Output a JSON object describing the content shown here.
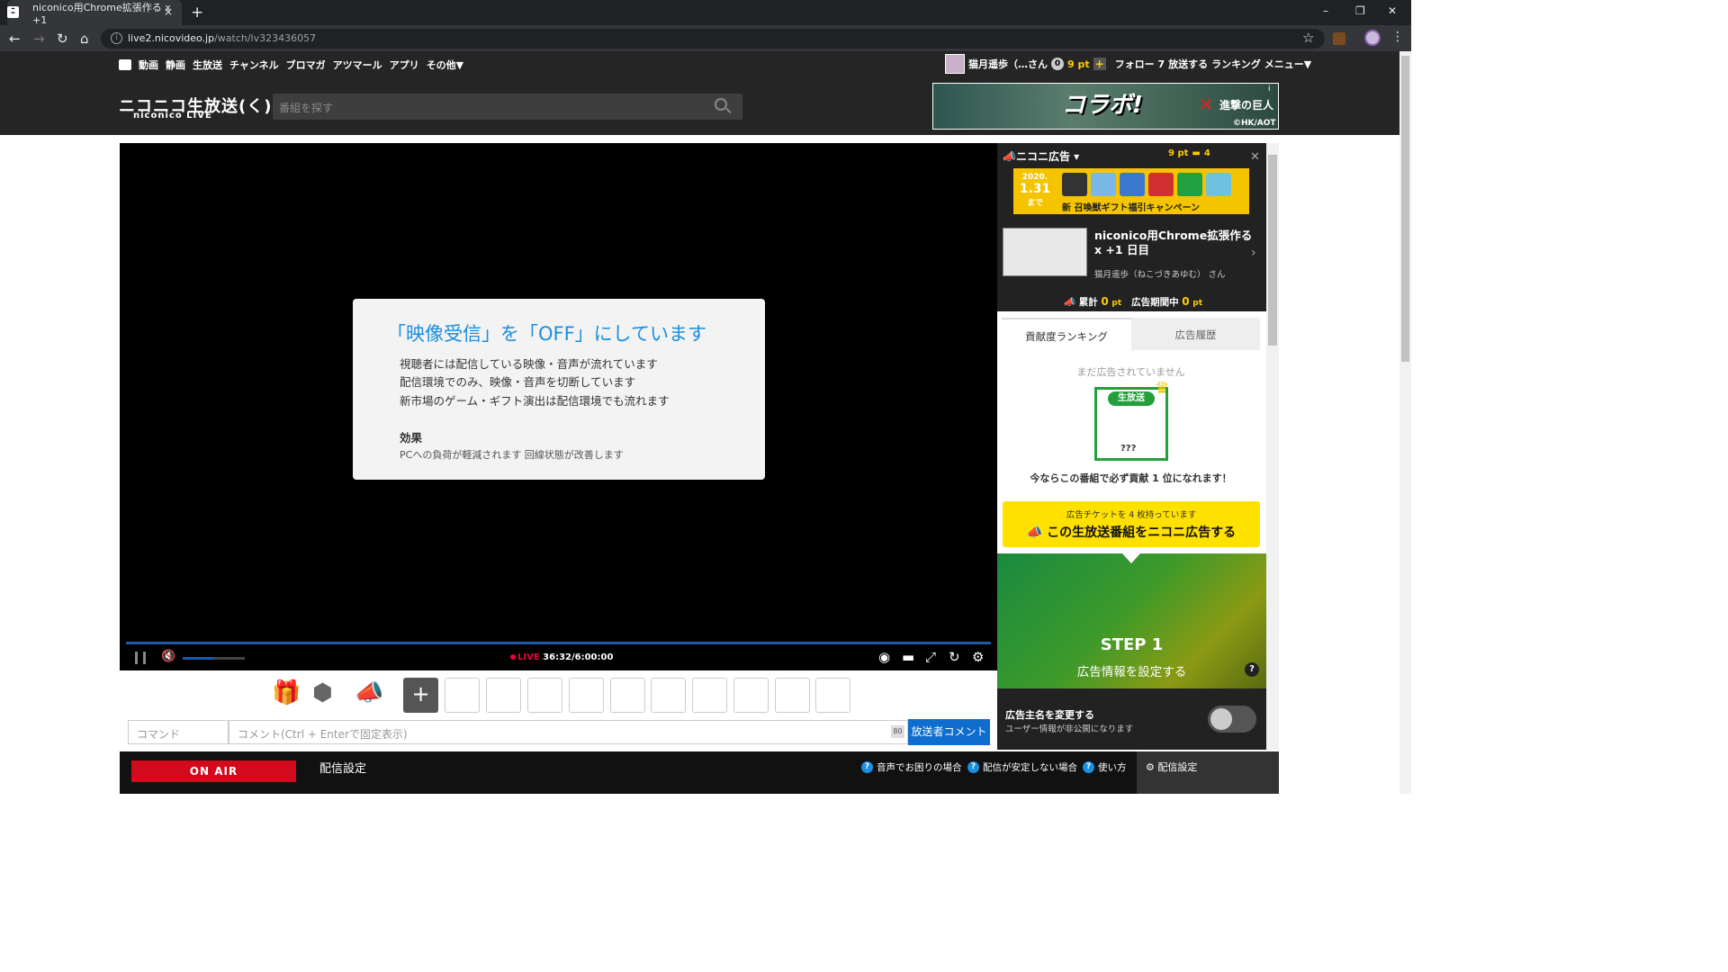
{
  "browser": {
    "tab_title": "niconico用Chrome拡張作る x +1",
    "favicon": "ﾆ",
    "new_tab": "+",
    "tab_close": "×",
    "url_host": "live2.nicovideo.jp",
    "url_path": "/watch/lv323436057",
    "window_controls": [
      "–",
      "❐",
      "✕"
    ]
  },
  "nico_header": {
    "nav": [
      "動画",
      "静画",
      "生放送",
      "チャンネル",
      "ブロマガ",
      "アツマール",
      "アプリ",
      "その他▼"
    ],
    "user_name": "猫月遥歩（…さん",
    "coins": "0",
    "points": "9 pt",
    "follow": "フォロー 7",
    "broadcast": "放送する",
    "ranking": "ランキング",
    "menu": "メニュー▼",
    "logo": "ニコニコ生放送(く)",
    "logo_sub": "niconico LIVE",
    "search_placeholder": "番組を探す",
    "banner": {
      "collab": "コラボ!",
      "title": "進撃の巨人",
      "copyright": "©HK/AOT",
      "info": "i"
    }
  },
  "player": {
    "message_title": "「映像受信」を「OFF」にしています",
    "message_lines": [
      "視聴者には配信している映像・音声が流れています",
      "配信環境でのみ、映像・音声を切断しています",
      "新市場のゲーム・ギフト演出は配信環境でも流れます"
    ],
    "effect_title": "効果",
    "effect_text": "PCへの負荷が軽減されます 回線状態が改善します",
    "live_label": "LIVE",
    "time": "36:32/6:00:00",
    "volume": 0.5
  },
  "comment": {
    "command_placeholder": "コマンド",
    "comment_placeholder": "コメント(Ctrl + Enterで固定表示)",
    "char_count": "80",
    "send_label": "放送者コメント",
    "plus": "+",
    "empty_slots": 10
  },
  "bottom": {
    "onair": "ON AIR",
    "settings_title": "配信設定",
    "help": [
      "音声でお困りの場合",
      "配信が安定しない場合",
      "使い方"
    ],
    "right_label": "配信設定"
  },
  "ad_panel": {
    "title": "ニコニ広告",
    "pts": "9 pt",
    "tickets": "4",
    "campaign_year": "2020.",
    "campaign_date": "1.31",
    "campaign_until": "まで",
    "campaign_text": "新 召喚獣ギフト福引キャンペーン",
    "program_title": "niconico用Chrome拡張作る x +1 日目",
    "program_user": "猫月遥歩（ねこづきあゆむ） さん",
    "total_label": "累計",
    "total_value": "0",
    "period_label": "広告期間中",
    "period_value": "0",
    "pt_unit": "pt",
    "tab_rank": "貢献度ランキング",
    "tab_history": "広告履歴",
    "no_ads": "まだ広告されていません",
    "rank_tag": "生放送",
    "rank_q": "???",
    "rank_msg": "今ならこの番組で必ず貢献 1 位になれます！",
    "ticket_msg": "広告チケットを 4 枚持っています",
    "ad_button": "この生放送番組をニコニ広告する",
    "step": "STEP 1",
    "step_label": "広告情報を設定する",
    "owner_title": "広告主名を変更する",
    "owner_sub": "ユーザー情報が非公開になります"
  }
}
